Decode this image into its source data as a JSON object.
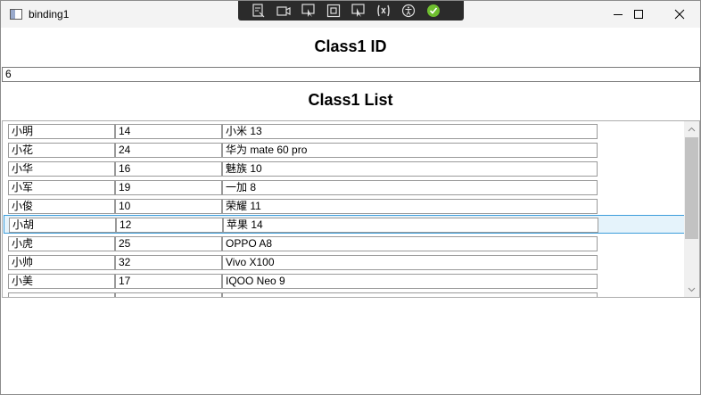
{
  "window": {
    "title": "binding1"
  },
  "devtools": {
    "tools": [
      "live-visual-tree-icon",
      "camera-icon",
      "select-element-icon",
      "display-layout-adorners-icon",
      "track-focus-icon",
      "binding-failures-icon",
      "accessibility-icon",
      "checkmark-icon"
    ]
  },
  "main": {
    "id_heading": "Class1 ID",
    "id_value": "6",
    "list_heading": "Class1 List",
    "rows": [
      {
        "name": "小明",
        "age": "14",
        "phone": "小米 13"
      },
      {
        "name": "小花",
        "age": "24",
        "phone": "华为 mate 60 pro"
      },
      {
        "name": "小华",
        "age": "16",
        "phone": "魅族 10"
      },
      {
        "name": "小军",
        "age": "19",
        "phone": "一加 8"
      },
      {
        "name": "小俊",
        "age": "10",
        "phone": "荣耀 11"
      },
      {
        "name": "小胡",
        "age": "12",
        "phone": "苹果 14"
      },
      {
        "name": "小虎",
        "age": "25",
        "phone": "OPPO A8"
      },
      {
        "name": "小帅",
        "age": "32",
        "phone": "Vivo X100"
      },
      {
        "name": "小美",
        "age": "17",
        "phone": "IQOO Neo 9"
      },
      {
        "name": "",
        "age": "",
        "phone": ""
      }
    ],
    "selected_index": 5
  },
  "colors": {
    "selection_background": "#e5f3fb",
    "selection_border": "#3c9ddb",
    "devbar_background": "#2b2b2b",
    "check_green": "#6fbf2f"
  }
}
